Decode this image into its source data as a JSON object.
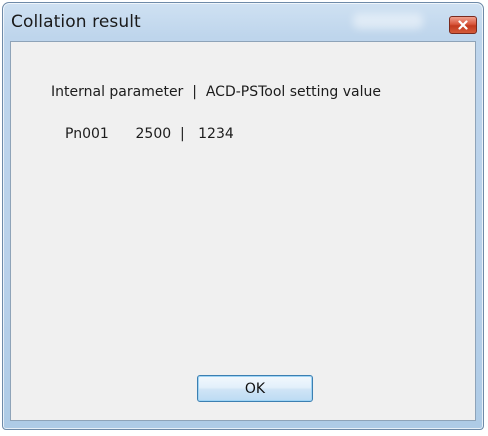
{
  "window": {
    "title": "Collation result",
    "close_icon": "close-icon"
  },
  "content": {
    "header": "Internal parameter  |  ACD-PSTool setting value",
    "row": {
      "param": "Pn001",
      "internal_value": "2500",
      "separator": "|",
      "setting_value": "1234"
    }
  },
  "buttons": {
    "ok_label": "OK"
  },
  "colors": {
    "titlebar": "#b9d1ea",
    "client": "#f0f0f0",
    "close_button": "#c33a1f",
    "ok_border": "#3c7fb1"
  }
}
